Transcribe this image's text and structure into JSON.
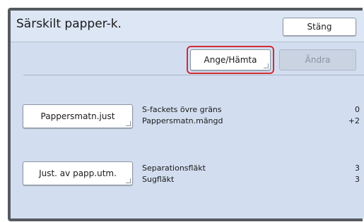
{
  "window": {
    "title": "Särskilt papper-k."
  },
  "header": {
    "close_label": "Stäng"
  },
  "toolbar": {
    "set_fetch_label": "Ange/Hämta",
    "change_label": "Ändra"
  },
  "sections": [
    {
      "button_label": "Pappersmatn.just",
      "settings": [
        {
          "label": "S-fackets övre gräns",
          "value": "0"
        },
        {
          "label": "Pappersmatn.mängd",
          "value": "+2"
        }
      ]
    },
    {
      "button_label": "Just. av papp.utm.",
      "settings": [
        {
          "label": "Separationsfläkt",
          "value": "3"
        },
        {
          "label": "Sugfläkt",
          "value": "3"
        }
      ]
    }
  ],
  "colors": {
    "panel": "#d2def0",
    "highlight": "#d42a35"
  }
}
